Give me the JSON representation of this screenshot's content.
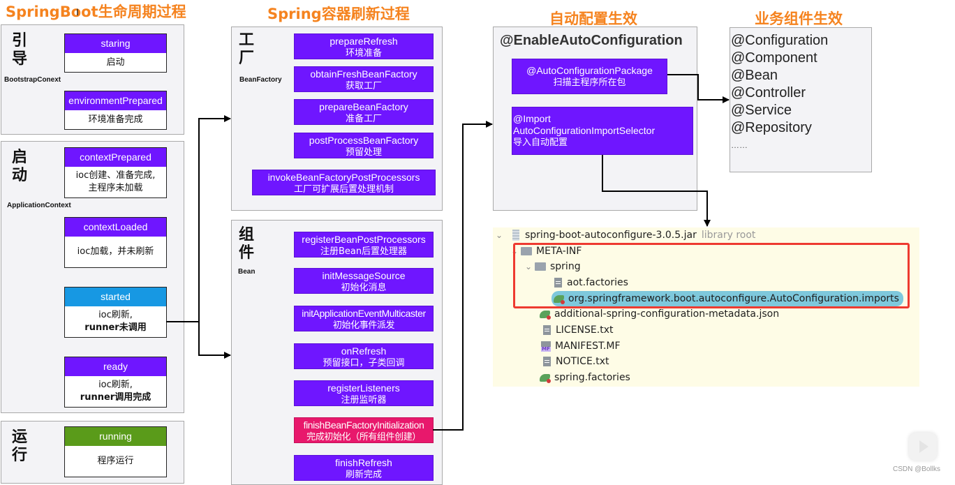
{
  "titles": {
    "lifecycle": "SpringBoot生命周期过程",
    "refresh": "Spring容器刷新过程",
    "autoconfig": "自动配置生效",
    "business": "业务组件生效"
  },
  "lifecycle": {
    "bootstrap": {
      "big_label": [
        "引",
        "导"
      ],
      "small_label": "BootstrapConext",
      "stages": [
        {
          "name": "staring",
          "desc": [
            "启动"
          ],
          "color": "#6f16ff"
        },
        {
          "name": "environmentPrepared",
          "desc": [
            "环境准备完成"
          ],
          "color": "#6f16ff"
        }
      ]
    },
    "startup": {
      "big_label": [
        "启",
        "动"
      ],
      "small_label": "ApplicationContext",
      "stages": [
        {
          "name": "contextPrepared",
          "desc": [
            "ioc创建、准备完成,",
            "主程序未加载"
          ],
          "color": "#6f16ff"
        },
        {
          "name": "contextLoaded",
          "desc": [
            "ioc加载，并未刷新"
          ],
          "color": "#6f16ff"
        },
        {
          "name": "started",
          "desc": [
            "ioc刷新,",
            "runner未调用"
          ],
          "color": "#1798e3"
        },
        {
          "name": "ready",
          "desc": [
            "ioc刷新,",
            "runner调用完成"
          ],
          "color": "#6f16ff"
        }
      ]
    },
    "running": {
      "big_label": [
        "运",
        "行"
      ],
      "stages": [
        {
          "name": "running",
          "desc": [
            "程序运行"
          ],
          "color": "#5a9b1a"
        }
      ]
    }
  },
  "refresh": {
    "factory": {
      "big_label": [
        "工",
        "厂"
      ],
      "small_label": "BeanFactory",
      "steps": [
        {
          "method": "prepareRefresh",
          "desc": "环境准备"
        },
        {
          "method": "obtainFreshBeanFactory",
          "desc": "获取工厂"
        },
        {
          "method": "prepareBeanFactory",
          "desc": "准备工厂"
        },
        {
          "method": "postProcessBeanFactory",
          "desc": "预留处理"
        },
        {
          "method": "invokeBeanFactoryPostProcessors",
          "desc": "工厂可扩展后置处理机制"
        }
      ]
    },
    "bean": {
      "big_label": [
        "组",
        "件"
      ],
      "small_label": "Bean",
      "steps": [
        {
          "method": "registerBeanPostProcessors",
          "desc": "注册Bean后置处理器"
        },
        {
          "method": "initMessageSource",
          "desc": "初始化消息"
        },
        {
          "method": "initApplicationEventMulticaster",
          "desc": "初始化事件派发"
        },
        {
          "method": "onRefresh",
          "desc": "预留接口，子类回调"
        },
        {
          "method": "registerListeners",
          "desc": "注册监听器"
        },
        {
          "method": "finishBeanFactoryInitialization",
          "desc": "完成初始化（所有组件创建）",
          "highlight": "#e8186c"
        },
        {
          "method": "finishRefresh",
          "desc": "刷新完成"
        }
      ]
    }
  },
  "autoconfig": {
    "header": "@EnableAutoConfiguration",
    "package_box": {
      "line1": "@AutoConfigurationPackage",
      "line2": "扫描主程序所在包"
    },
    "import_box": {
      "line1": "@Import",
      "line2": "AutoConfigurationImportSelector",
      "line3": "导入自动配置"
    }
  },
  "business": {
    "annotations": [
      "@Configuration",
      "@Component",
      "@Bean",
      "@Controller",
      "@Service",
      "@Repository",
      "……"
    ]
  },
  "file_tree": {
    "root": {
      "name": "spring-boot-autoconfigure-3.0.5.jar",
      "suffix": "library root",
      "icon": "jar-icon"
    },
    "items": [
      {
        "name": "META-INF",
        "icon": "folder-icon",
        "level": 1
      },
      {
        "name": "spring",
        "icon": "folder-icon",
        "level": 2,
        "expanded": true
      },
      {
        "name": "aot.factories",
        "icon": "file-icon",
        "level": 3
      },
      {
        "name": "org.springframework.boot.autoconfigure.AutoConfiguration.imports",
        "icon": "spring-icon",
        "level": 3,
        "selected": true
      },
      {
        "name": "additional-spring-configuration-metadata.json",
        "icon": "spring-config-icon",
        "level": 2
      },
      {
        "name": "LICENSE.txt",
        "icon": "file-icon",
        "level": 2
      },
      {
        "name": "MANIFEST.MF",
        "icon": "manifest-icon",
        "level": 2
      },
      {
        "name": "NOTICE.txt",
        "icon": "file-icon",
        "level": 2
      },
      {
        "name": "spring.factories",
        "icon": "spring-icon",
        "level": 2
      }
    ],
    "highlight_color": "#ee3a30",
    "selected_color": "#7ec8dc"
  },
  "watermark": "CSDN @Bollks"
}
